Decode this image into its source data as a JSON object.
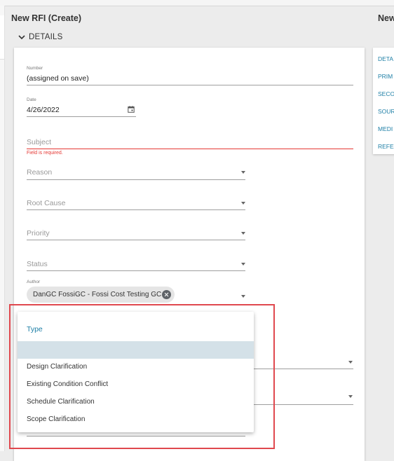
{
  "header": {
    "title": "New RFI (Create)",
    "right_title": "New"
  },
  "section": {
    "label": "DETAILS"
  },
  "side_nav": {
    "items": [
      "DETA",
      "PRIM",
      "SECO",
      "SOUR",
      "MEDI",
      "REFE"
    ]
  },
  "form": {
    "number": {
      "label": "Number",
      "value": "(assigned on save)"
    },
    "date": {
      "label": "Date",
      "value": "4/26/2022"
    },
    "subject": {
      "placeholder": "Subject",
      "error": "Field is required."
    },
    "reason": {
      "placeholder": "Reason"
    },
    "root_cause": {
      "placeholder": "Root Cause"
    },
    "priority": {
      "placeholder": "Priority"
    },
    "status": {
      "placeholder": "Status"
    },
    "author": {
      "label": "Author",
      "chip": "DanGC FossiGC - Fossi Cost Testing GC"
    }
  },
  "type_dropdown": {
    "header": "Type",
    "selected": "",
    "options": [
      "Design Clarification",
      "Existing Condition Conflict",
      "Schedule Clarification",
      "Scope Clarification"
    ]
  },
  "colors": {
    "accent": "#1e7fa6",
    "error": "#e53935",
    "highlight": "#d4e1e8",
    "annotation": "#e0484e"
  }
}
